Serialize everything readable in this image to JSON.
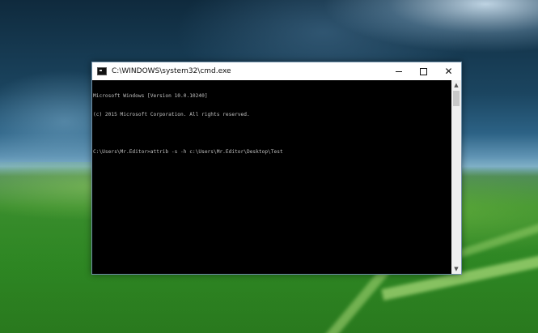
{
  "window": {
    "title": "C:\\WINDOWS\\system32\\cmd.exe",
    "icon": "cmd-icon"
  },
  "controls": {
    "minimize": "minimize-icon",
    "maximize": "maximize-icon",
    "close": "✕"
  },
  "console": {
    "lines": [
      "Microsoft Windows [Version 10.0.10240]",
      "(c) 2015 Microsoft Corporation. All rights reserved.",
      "",
      "C:\\Users\\Mr.Editor>attrib -s -h c:\\Users\\Mr.Editor\\Desktop\\Test"
    ]
  },
  "scrollbar": {
    "up": "▲",
    "down": "▼"
  }
}
